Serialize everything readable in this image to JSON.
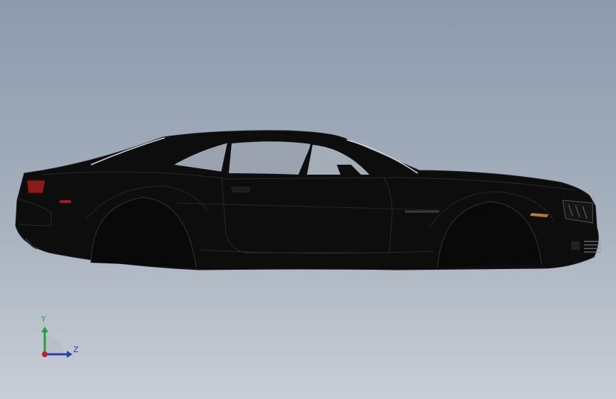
{
  "viewport": {
    "background_top": "#8c9aac",
    "background_bottom": "#c9ced6"
  },
  "model": {
    "body_color": "#0d0d0d",
    "glass_color": "#9aa3af",
    "taillight_color": "#8b1a1a",
    "marker_color": "#c07a2a"
  },
  "triad": {
    "y_label": "Y",
    "z_label": "Z",
    "y_color": "#20a040",
    "z_color": "#2a3cb0",
    "x_color": "#c02020"
  }
}
